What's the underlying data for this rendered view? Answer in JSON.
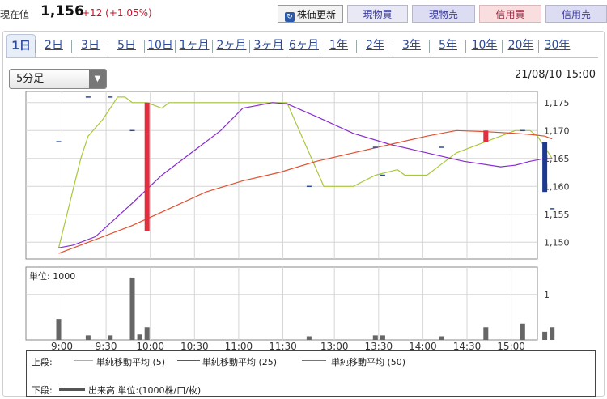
{
  "header": {
    "price_label": "現在値",
    "price_value": "1,156",
    "price_change": "+12 (+1.05%)"
  },
  "buttons": {
    "refresh": "株価更新",
    "spot_buy": "現物買",
    "spot_sell": "現物売",
    "margin_buy": "信用買",
    "margin_sell": "信用売"
  },
  "tabs": [
    "1日",
    "2日",
    "3日",
    "5日",
    "10日",
    "1ヶ月",
    "2ヶ月",
    "3ヶ月",
    "6ヶ月",
    "1年",
    "2年",
    "3年",
    "5年",
    "10年",
    "20年",
    "30年"
  ],
  "interval": {
    "selected": "5分足"
  },
  "timestamp": "21/08/10 15:00",
  "legend": {
    "upper_label": "上段:",
    "lower_label": "下段:",
    "ma5": "単純移動平均 (5)",
    "ma25": "単純移動平均 (25)",
    "ma50": "単純移動平均 (50)",
    "volume": "出来高 単位:(1000株/口/枚)"
  },
  "colors": {
    "up_candle": "#e03040",
    "down_candle": "#1e3a90",
    "ma5": "#a8c83c",
    "ma25": "#8a2ad0",
    "ma50": "#e05030",
    "volume_bar": "#666666"
  },
  "chart_data": [
    {
      "type": "candlestick",
      "x_tick_labels": [
        "9:00",
        "9:30",
        "10:00",
        "10:30",
        "11:00",
        "11:30",
        "13:00",
        "13:30",
        "14:00",
        "14:30",
        "15:00"
      ],
      "y_tick_labels": [
        "1,150",
        "1,155",
        "1,160",
        "1,165",
        "1,170",
        "1,175"
      ],
      "ylim": [
        1147,
        1177
      ],
      "grid": true,
      "candles": [
        {
          "slot": 0,
          "open": 1168,
          "close": 1168
        },
        {
          "slot": 4,
          "open": 1176,
          "close": 1176
        },
        {
          "slot": 7,
          "open": 1176,
          "close": 1176
        },
        {
          "slot": 10,
          "open": 1170,
          "close": 1170
        },
        {
          "slot": 12,
          "open": 1152,
          "close": 1175
        },
        {
          "slot": 34,
          "open": 1160,
          "close": 1160
        },
        {
          "slot": 43,
          "open": 1167,
          "close": 1167
        },
        {
          "slot": 44,
          "open": 1162,
          "close": 1162
        },
        {
          "slot": 52,
          "open": 1167,
          "close": 1167
        },
        {
          "slot": 58,
          "open": 1168,
          "close": 1170
        },
        {
          "slot": 63,
          "open": 1170,
          "close": 1170
        },
        {
          "slot": 66,
          "open": 1168,
          "close": 1159
        },
        {
          "slot": 67,
          "open": 1156,
          "close": 1156
        }
      ],
      "series": [
        {
          "name": "単純移動平均 (5)",
          "points": [
            [
              0,
              1149
            ],
            [
              3,
              1165
            ],
            [
              4,
              1169
            ],
            [
              6,
              1172
            ],
            [
              8,
              1176
            ],
            [
              9,
              1176
            ],
            [
              10,
              1175
            ],
            [
              12,
              1175
            ],
            [
              14,
              1174
            ],
            [
              15,
              1175
            ],
            [
              30,
              1175
            ],
            [
              31,
              1175
            ],
            [
              36,
              1160
            ],
            [
              40,
              1160
            ],
            [
              43,
              1162
            ],
            [
              46,
              1163
            ],
            [
              47,
              1162
            ],
            [
              50,
              1162
            ],
            [
              52,
              1164
            ],
            [
              54,
              1166
            ],
            [
              58,
              1168
            ],
            [
              60,
              1169
            ],
            [
              62,
              1170
            ],
            [
              64,
              1170
            ],
            [
              65,
              1169
            ],
            [
              67,
              1165
            ]
          ]
        },
        {
          "name": "単純移動平均 (25)",
          "points": [
            [
              0,
              1149
            ],
            [
              2,
              1149.5
            ],
            [
              5,
              1151
            ],
            [
              10,
              1157
            ],
            [
              14,
              1162
            ],
            [
              18,
              1166
            ],
            [
              22,
              1170
            ],
            [
              25,
              1174
            ],
            [
              27,
              1174.5
            ],
            [
              29,
              1175
            ],
            [
              31,
              1174.8
            ],
            [
              35,
              1172.5
            ],
            [
              40,
              1169.5
            ],
            [
              45,
              1167.5
            ],
            [
              50,
              1166
            ],
            [
              55,
              1164.5
            ],
            [
              60,
              1163.5
            ],
            [
              62,
              1163.8
            ],
            [
              64,
              1164.5
            ],
            [
              66,
              1165
            ],
            [
              67,
              1165
            ]
          ]
        },
        {
          "name": "単純移動平均 (50)",
          "points": [
            [
              0,
              1148
            ],
            [
              5,
              1150.5
            ],
            [
              10,
              1153
            ],
            [
              15,
              1156
            ],
            [
              20,
              1159
            ],
            [
              25,
              1161
            ],
            [
              30,
              1162.5
            ],
            [
              35,
              1164.5
            ],
            [
              40,
              1166
            ],
            [
              45,
              1167.5
            ],
            [
              50,
              1169
            ],
            [
              54,
              1170
            ],
            [
              58,
              1169.8
            ],
            [
              62,
              1169.5
            ],
            [
              64,
              1169.3
            ],
            [
              66,
              1169
            ],
            [
              67,
              1168.5
            ]
          ]
        }
      ]
    },
    {
      "type": "bar",
      "title": "単位: 1000",
      "x_tick_labels": [
        "9:00",
        "9:30",
        "10:00",
        "10:30",
        "11:00",
        "11:30",
        "13:00",
        "13:30",
        "14:00",
        "14:30",
        "15:00"
      ],
      "y_tick_labels": [
        "1"
      ],
      "ylim": [
        0,
        1.6
      ],
      "series": [
        {
          "slots": [
            0,
            4,
            7,
            10,
            11,
            12,
            34,
            43,
            44,
            52,
            58,
            63,
            66,
            67
          ],
          "values": [
            0.46,
            0.1,
            0.1,
            1.37,
            0.12,
            0.28,
            0.08,
            0.1,
            0.1,
            0.08,
            0.28,
            0.36,
            0.18,
            0.28
          ]
        }
      ]
    }
  ]
}
